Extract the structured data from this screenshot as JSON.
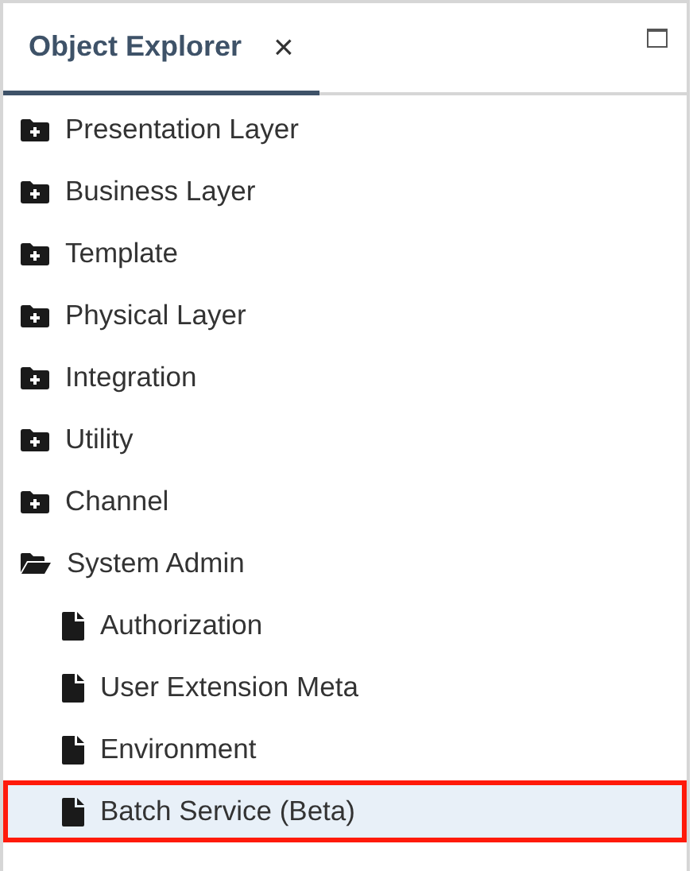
{
  "tab": {
    "title": "Object Explorer",
    "close": "×",
    "selected": true
  },
  "tree": [
    {
      "kind": "folder",
      "label": "Presentation Layer",
      "expanded": false,
      "selected": false,
      "highlighted": false
    },
    {
      "kind": "folder",
      "label": "Business Layer",
      "expanded": false,
      "selected": false,
      "highlighted": false
    },
    {
      "kind": "folder",
      "label": "Template",
      "expanded": false,
      "selected": false,
      "highlighted": false
    },
    {
      "kind": "folder",
      "label": "Physical Layer",
      "expanded": false,
      "selected": false,
      "highlighted": false
    },
    {
      "kind": "folder",
      "label": "Integration",
      "expanded": false,
      "selected": false,
      "highlighted": false
    },
    {
      "kind": "folder",
      "label": "Utility",
      "expanded": false,
      "selected": false,
      "highlighted": false
    },
    {
      "kind": "folder",
      "label": "Channel",
      "expanded": false,
      "selected": false,
      "highlighted": false
    },
    {
      "kind": "folder",
      "label": "System Admin",
      "expanded": true,
      "selected": false,
      "highlighted": false,
      "children": [
        {
          "kind": "document",
          "label": "Authorization",
          "selected": false,
          "highlighted": false
        },
        {
          "kind": "document",
          "label": "User Extension Meta",
          "selected": false,
          "highlighted": false
        },
        {
          "kind": "document",
          "label": "Environment",
          "selected": false,
          "highlighted": false
        },
        {
          "kind": "document",
          "label": "Batch Service (Beta)",
          "selected": true,
          "highlighted": true
        }
      ]
    }
  ]
}
